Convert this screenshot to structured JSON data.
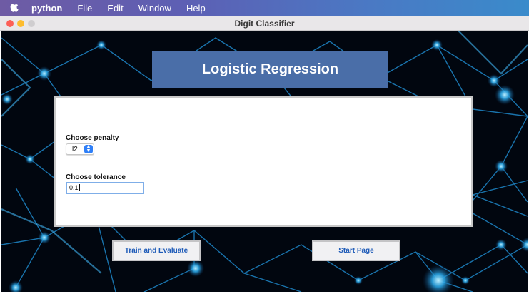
{
  "menubar": {
    "app": "python",
    "items": [
      "File",
      "Edit",
      "Window",
      "Help"
    ]
  },
  "window": {
    "title": "Digit Classifier"
  },
  "page": {
    "heading": "Logistic Regression"
  },
  "penalty": {
    "label": "Choose penalty",
    "value": "l2"
  },
  "tolerance": {
    "label": "Choose tolerance",
    "value": "0.1"
  },
  "buttons": {
    "train": "Train and Evaluate",
    "start": "Start Page"
  },
  "colors": {
    "heading_bg": "#4a6ea8",
    "button_text": "#1e5bb8",
    "accent": "#2f7ff7"
  }
}
